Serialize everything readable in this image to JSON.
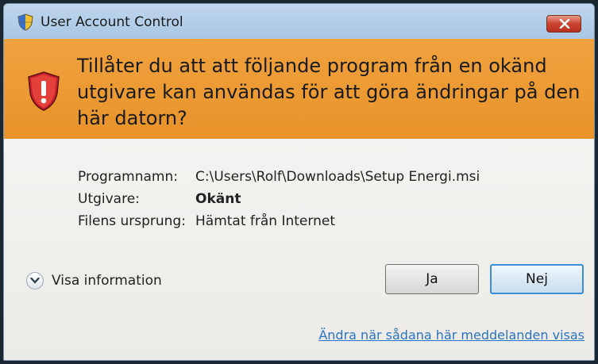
{
  "window": {
    "title": "User Account Control"
  },
  "banner": {
    "message": "Tillåter du att att följande program från en okänd utgivare kan användas för att göra ändringar på den här datorn?"
  },
  "details": [
    {
      "label": "Programnamn:",
      "value": "C:\\Users\\Rolf\\Downloads\\Setup Energi.msi",
      "bold": false
    },
    {
      "label": "Utgivare:",
      "value": "Okänt",
      "bold": true
    },
    {
      "label": "Filens ursprung:",
      "value": "Hämtat från Internet",
      "bold": false
    }
  ],
  "footer": {
    "show_info_label": "Visa information",
    "yes_label": "Ja",
    "no_label": "Nej",
    "change_link": "Ändra när sådana här meddelanden visas"
  },
  "colors": {
    "banner": "#e8932a",
    "titlebar": "#a9c6e4",
    "link": "#2b73c4"
  },
  "icons": {
    "title": "uac-shield-icon",
    "banner": "warning-shield-icon",
    "close": "close-icon",
    "expand": "chevron-down-icon"
  }
}
